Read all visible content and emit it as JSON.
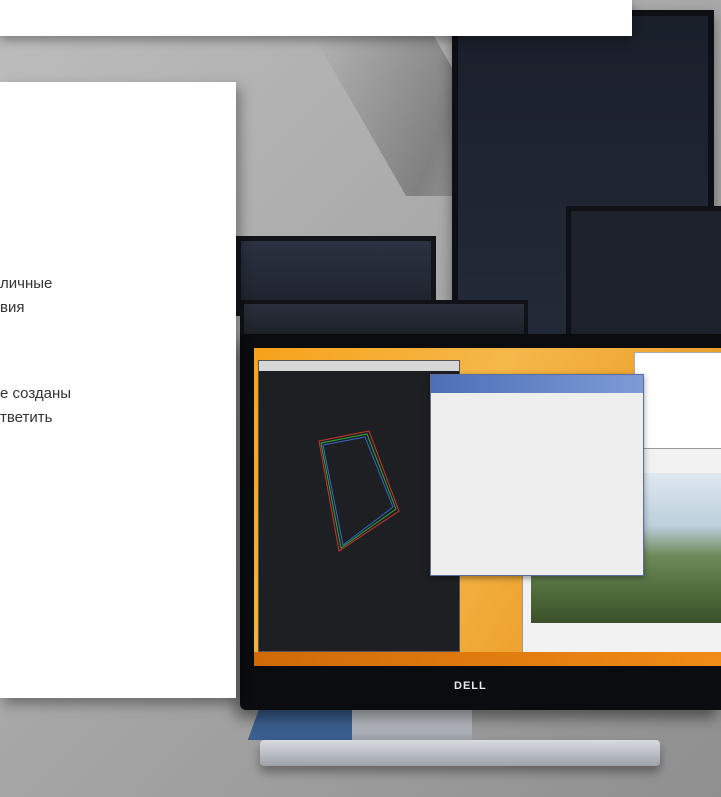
{
  "text_card": {
    "line1": "личные",
    "line2": "вия",
    "line3": "е созданы",
    "line4": "тветить"
  },
  "monitor": {
    "brand": "DELL"
  },
  "colors": {
    "card": "#ffffff",
    "screen_orange": "#f5a623",
    "dialog_title": "#4c6fb6",
    "stand_accent": "#3a5f8f"
  }
}
